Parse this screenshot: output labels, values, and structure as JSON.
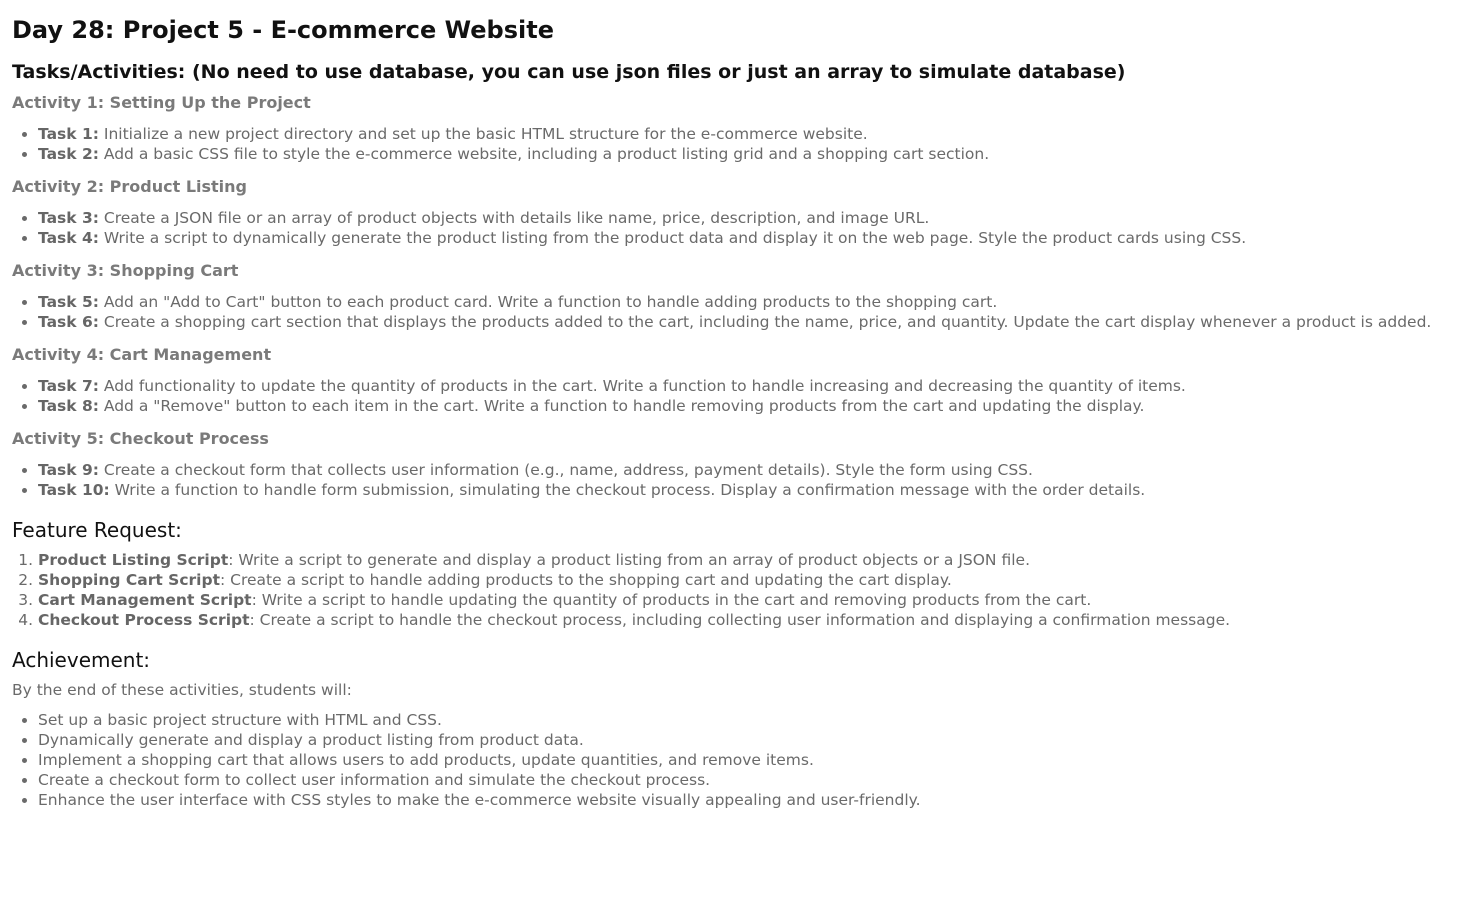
{
  "title": "Day 28: Project 5 - E-commerce Website",
  "tasks_heading": "Tasks/Activities: (No need to use database, you can use json files or just an array to simulate database)",
  "activities": [
    {
      "title": "Activity 1: Setting Up the Project",
      "tasks": [
        {
          "label": "Task 1:",
          "text": " Initialize a new project directory and set up the basic HTML structure for the e-commerce website."
        },
        {
          "label": "Task 2:",
          "text": " Add a basic CSS file to style the e-commerce website, including a product listing grid and a shopping cart section."
        }
      ]
    },
    {
      "title": "Activity 2: Product Listing",
      "tasks": [
        {
          "label": "Task 3:",
          "text": " Create a JSON file or an array of product objects with details like name, price, description, and image URL."
        },
        {
          "label": "Task 4:",
          "text": " Write a script to dynamically generate the product listing from the product data and display it on the web page. Style the product cards using CSS."
        }
      ]
    },
    {
      "title": "Activity 3: Shopping Cart",
      "tasks": [
        {
          "label": "Task 5:",
          "text": " Add an \"Add to Cart\" button to each product card. Write a function to handle adding products to the shopping cart."
        },
        {
          "label": "Task 6:",
          "text": " Create a shopping cart section that displays the products added to the cart, including the name, price, and quantity. Update the cart display whenever a product is added."
        }
      ]
    },
    {
      "title": "Activity 4: Cart Management",
      "tasks": [
        {
          "label": "Task 7:",
          "text": " Add functionality to update the quantity of products in the cart. Write a function to handle increasing and decreasing the quantity of items."
        },
        {
          "label": "Task 8:",
          "text": " Add a \"Remove\" button to each item in the cart. Write a function to handle removing products from the cart and updating the display."
        }
      ]
    },
    {
      "title": "Activity 5: Checkout Process",
      "tasks": [
        {
          "label": "Task 9:",
          "text": " Create a checkout form that collects user information (e.g., name, address, payment details). Style the form using CSS."
        },
        {
          "label": "Task 10:",
          "text": " Write a function to handle form submission, simulating the checkout process. Display a confirmation message with the order details."
        }
      ]
    }
  ],
  "feature_request": {
    "heading": "Feature Request:",
    "items": [
      {
        "label": "Product Listing Script",
        "text": ": Write a script to generate and display a product listing from an array of product objects or a JSON file."
      },
      {
        "label": "Shopping Cart Script",
        "text": ": Create a script to handle adding products to the shopping cart and updating the cart display."
      },
      {
        "label": "Cart Management Script",
        "text": ": Write a script to handle updating the quantity of products in the cart and removing products from the cart."
      },
      {
        "label": "Checkout Process Script",
        "text": ": Create a script to handle the checkout process, including collecting user information and displaying a confirmation message."
      }
    ]
  },
  "achievement": {
    "heading": "Achievement:",
    "intro": "By the end of these activities, students will:",
    "items": [
      "Set up a basic project structure with HTML and CSS.",
      "Dynamically generate and display a product listing from product data.",
      "Implement a shopping cart that allows users to add products, update quantities, and remove items.",
      "Create a checkout form to collect user information and simulate the checkout process.",
      "Enhance the user interface with CSS styles to make the e-commerce website visually appealing and user-friendly."
    ]
  }
}
